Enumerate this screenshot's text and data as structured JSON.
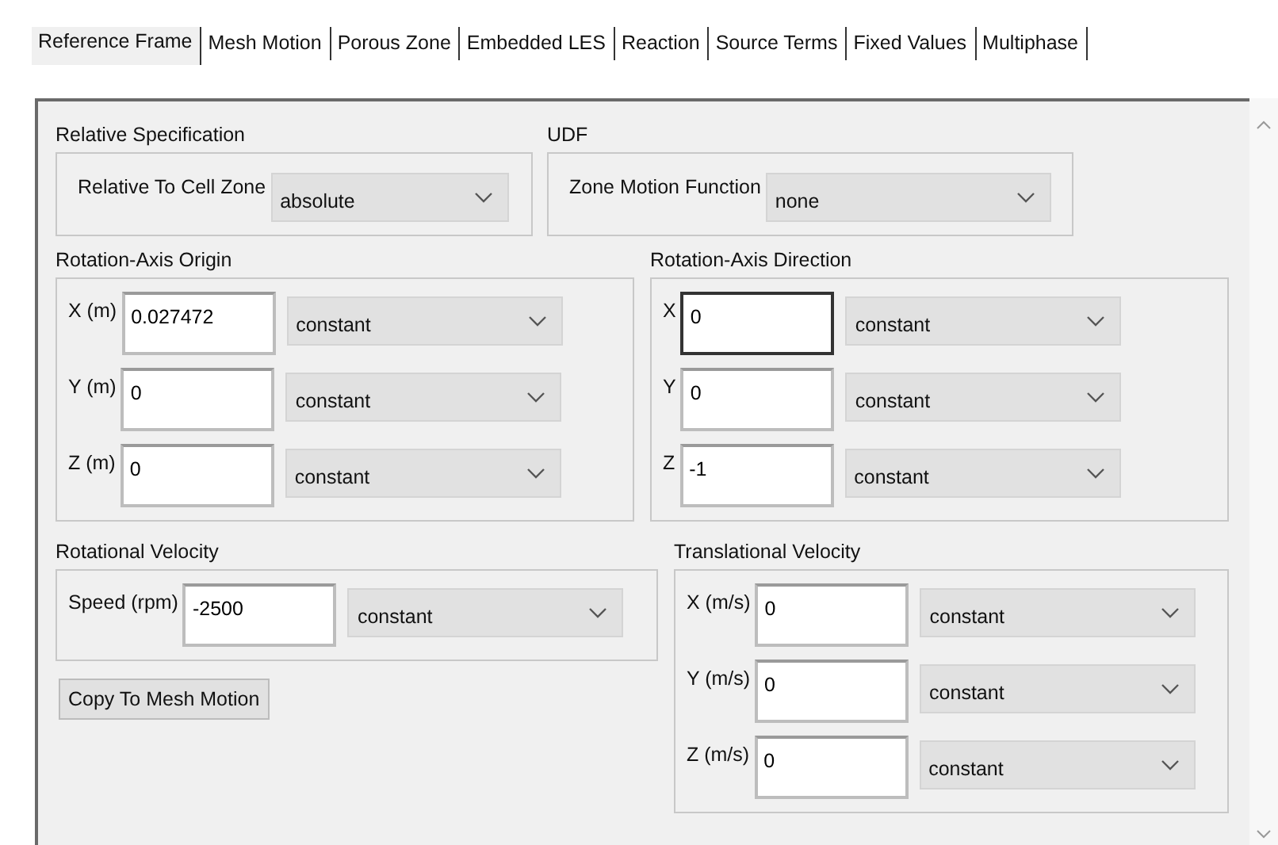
{
  "tabs": [
    {
      "label": "Reference Frame",
      "selected": true
    },
    {
      "label": "Mesh Motion",
      "selected": false
    },
    {
      "label": "Porous Zone",
      "selected": false
    },
    {
      "label": "Embedded LES",
      "selected": false
    },
    {
      "label": "Reaction",
      "selected": false
    },
    {
      "label": "Source Terms",
      "selected": false
    },
    {
      "label": "Fixed Values",
      "selected": false
    },
    {
      "label": "Multiphase",
      "selected": false
    }
  ],
  "sections": [
    {
      "kind": "select",
      "title": "Relative Specification",
      "label": "Relative To Cell Zone",
      "value": "absolute"
    },
    {
      "kind": "select",
      "title": "UDF",
      "label": "Zone Motion Function",
      "value": "none"
    },
    {
      "kind": "vector",
      "title": "Rotation-Axis Origin",
      "rows": [
        {
          "label": "X (m)",
          "value": "0.027472",
          "method": "constant",
          "focused": false
        },
        {
          "label": "Y (m)",
          "value": "0",
          "method": "constant",
          "focused": false
        },
        {
          "label": "Z (m)",
          "value": "0",
          "method": "constant",
          "focused": false
        }
      ]
    },
    {
      "kind": "vector",
      "title": "Rotation-Axis Direction",
      "rows": [
        {
          "label": "X",
          "value": "0",
          "method": "constant",
          "focused": true
        },
        {
          "label": "Y",
          "value": "0",
          "method": "constant",
          "focused": false
        },
        {
          "label": "Z",
          "value": "-1",
          "method": "constant",
          "focused": false
        }
      ]
    },
    {
      "kind": "vector",
      "title": "Rotational Velocity",
      "rows": [
        {
          "label": "Speed (rpm)",
          "value": "-2500",
          "method": "constant",
          "focused": false
        }
      ]
    },
    {
      "kind": "vector",
      "title": "Translational Velocity",
      "rows": [
        {
          "label": "X (m/s)",
          "value": "0",
          "method": "constant",
          "focused": false
        },
        {
          "label": "Y (m/s)",
          "value": "0",
          "method": "constant",
          "focused": false
        },
        {
          "label": "Z (m/s)",
          "value": "0",
          "method": "constant",
          "focused": false
        }
      ]
    }
  ],
  "copy_button": "Copy To Mesh Motion"
}
